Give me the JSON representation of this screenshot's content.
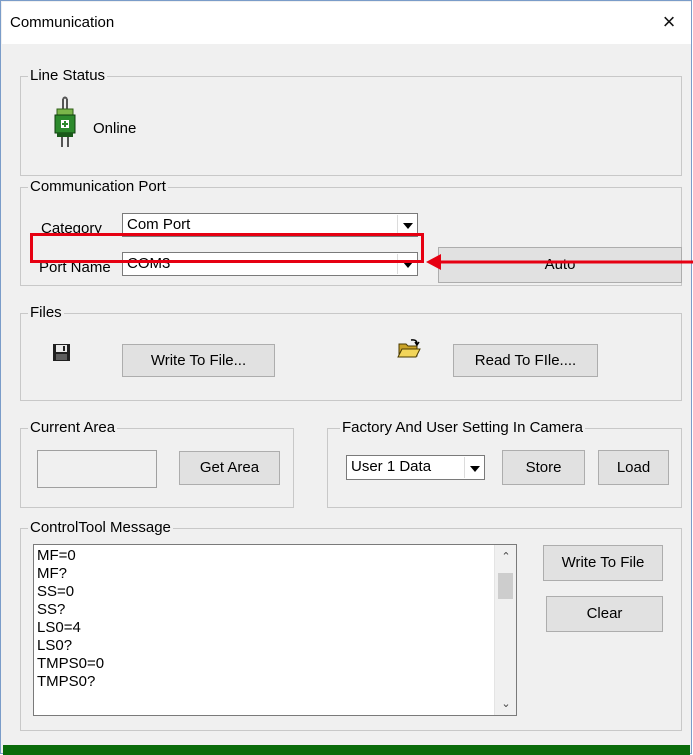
{
  "window": {
    "title": "Communication",
    "close_glyph": "×"
  },
  "line_status": {
    "legend": "Line Status",
    "icon": "plug-connected-icon",
    "status": "Online"
  },
  "comm_port": {
    "legend": "Communication Port",
    "category_label": "Category",
    "category_value": "Com Port",
    "port_label": "Port Name",
    "port_value": "COM3",
    "auto_button": "Auto"
  },
  "files": {
    "legend": "Files",
    "save_icon": "floppy-disk-icon",
    "open_icon": "open-folder-icon",
    "write_button": "Write To File...",
    "read_button": "Read To FIle...."
  },
  "current_area": {
    "legend": "Current Area",
    "area_value": "",
    "get_area_button": "Get Area"
  },
  "factory": {
    "legend": "Factory And User Setting In Camera",
    "data_select": "User 1 Data",
    "store_button": "Store",
    "load_button": "Load"
  },
  "message": {
    "legend": "ControlTool Message",
    "lines": [
      "MF=0",
      "MF?",
      "SS=0",
      "SS?",
      "LS0=4",
      "LS0?",
      "TMPS0=0",
      "TMPS0?"
    ],
    "write_button": "Write To File",
    "clear_button": "Clear"
  },
  "annotation": {
    "highlight_color": "#e60012",
    "arrow_color": "#e60012"
  }
}
